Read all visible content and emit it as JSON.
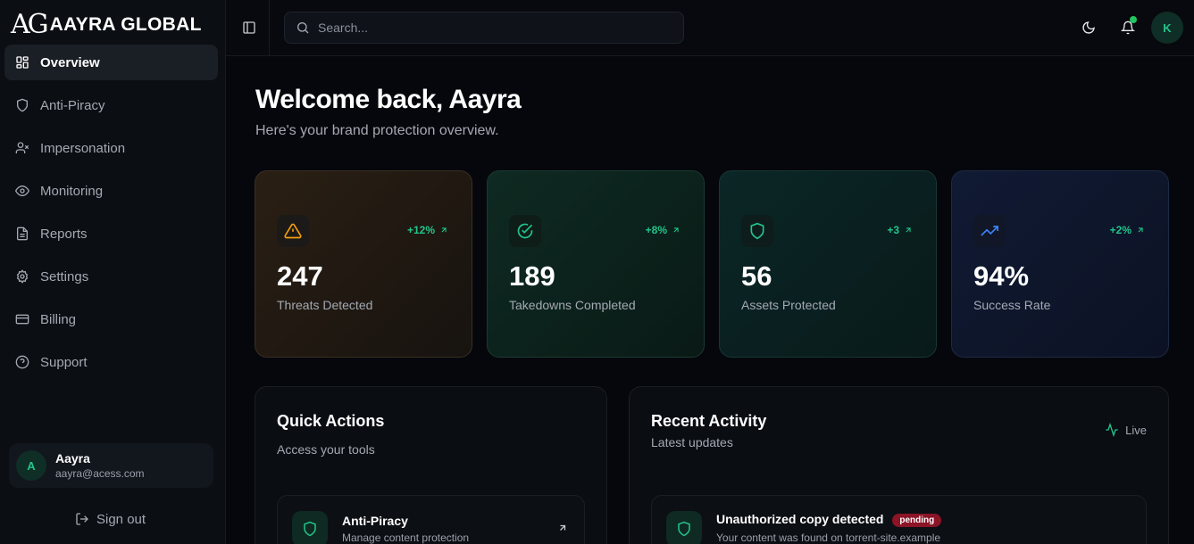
{
  "brand": {
    "mark": "AG",
    "name": "AAYRA GLOBAL"
  },
  "sidebar": {
    "items": [
      {
        "label": "Overview",
        "icon": "grid-icon",
        "active": true
      },
      {
        "label": "Anti-Piracy",
        "icon": "shield-icon"
      },
      {
        "label": "Impersonation",
        "icon": "user-x-icon"
      },
      {
        "label": "Monitoring",
        "icon": "eye-icon"
      },
      {
        "label": "Reports",
        "icon": "file-text-icon"
      },
      {
        "label": "Settings",
        "icon": "gear-icon"
      },
      {
        "label": "Billing",
        "icon": "credit-card-icon"
      },
      {
        "label": "Support",
        "icon": "help-circle-icon"
      }
    ],
    "user": {
      "initial": "A",
      "name": "Aayra",
      "email": "aayra@acess.com"
    },
    "signout_label": "Sign out"
  },
  "header": {
    "search_placeholder": "Search...",
    "avatar_initial": "K"
  },
  "main": {
    "title": "Welcome back, Aayra",
    "subtitle": "Here's your brand protection overview.",
    "stats": [
      {
        "value": "247",
        "label": "Threats Detected",
        "change": "+12%",
        "icon": "alert-triangle-icon",
        "accent": "#f59e0b"
      },
      {
        "value": "189",
        "label": "Takedowns Completed",
        "change": "+8%",
        "icon": "check-circle-icon",
        "accent": "#22c58b"
      },
      {
        "value": "56",
        "label": "Assets Protected",
        "change": "+3",
        "icon": "shield-icon",
        "accent": "#22c58b"
      },
      {
        "value": "94%",
        "label": "Success Rate",
        "change": "+2%",
        "icon": "trending-up-icon",
        "accent": "#3b82f6"
      }
    ],
    "quick_actions": {
      "title": "Quick Actions",
      "subtitle": "Access your tools",
      "items": [
        {
          "title": "Anti-Piracy",
          "desc": "Manage content protection"
        }
      ]
    },
    "recent_activity": {
      "title": "Recent Activity",
      "subtitle": "Latest updates",
      "live_label": "Live",
      "items": [
        {
          "title": "Unauthorized copy detected",
          "badge": "pending",
          "desc": "Your content was found on torrent-site.example"
        }
      ]
    }
  },
  "colors": {
    "positive": "#22c58b",
    "warning": "#f59e0b",
    "info": "#3b82f6",
    "badge_pending": "#8b1427"
  }
}
